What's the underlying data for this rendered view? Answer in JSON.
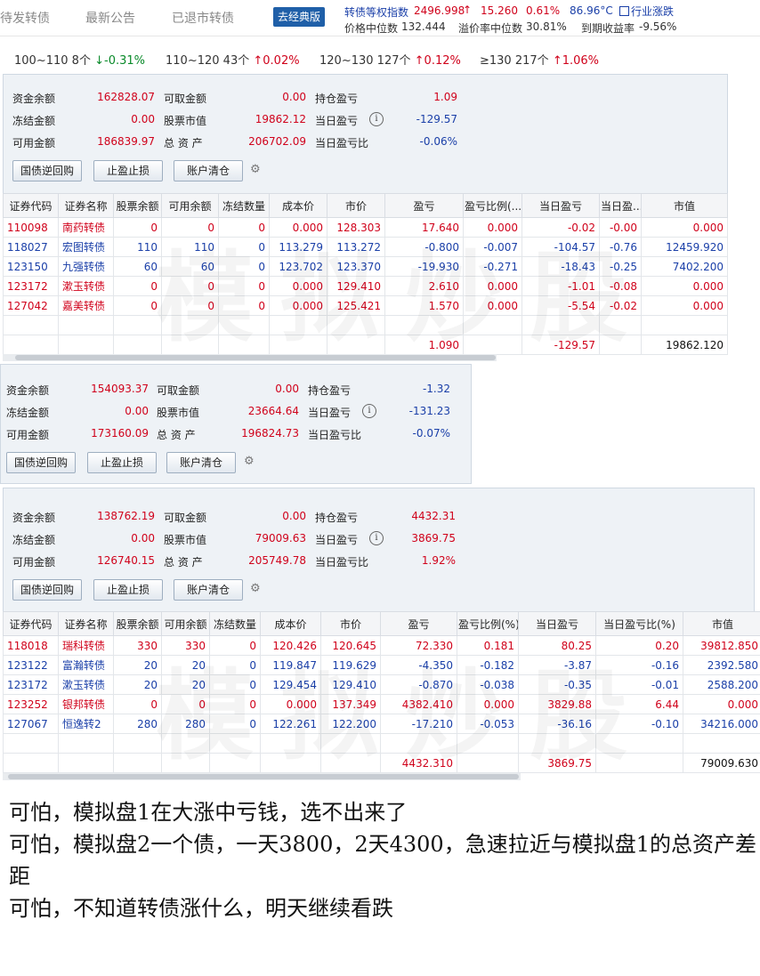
{
  "topbar": {
    "tabs": [
      "待发转债",
      "最新公告",
      "已退市转债"
    ],
    "classic_button": "去经典版",
    "index_label": "转债等权指数",
    "index_value": "2496.998",
    "index_arrow": "↑",
    "index_change": "15.260",
    "index_pct": "0.61%",
    "temperature": "86.96°C",
    "industry_link": "行业涨跌",
    "median_price_label": "价格中位数",
    "median_price": "132.444",
    "premium_median_label": "溢价率中位数",
    "premium_median": "30.81%",
    "ytm_label": "到期收益率",
    "ytm": "-9.56%"
  },
  "ranges": [
    {
      "range": "100~110",
      "count": "8个",
      "arrow": "↓",
      "pct": "-0.31%",
      "color": "green"
    },
    {
      "range": "110~120",
      "count": "43个",
      "arrow": "↑",
      "pct": "0.02%",
      "color": "red"
    },
    {
      "range": "120~130",
      "count": "127个",
      "arrow": "↑",
      "pct": "0.12%",
      "color": "red"
    },
    {
      "range": "≥130",
      "count": "217个",
      "arrow": "↑",
      "pct": "1.06%",
      "color": "red"
    }
  ],
  "labels": {
    "cash_balance": "资金余额",
    "withdrawable": "可取金额",
    "position_pnl": "持仓盈亏",
    "frozen": "冻结金额",
    "stock_value": "股票市值",
    "day_pnl": "当日盈亏",
    "available": "可用金额",
    "total_assets": "总 资 产",
    "day_pnl_ratio": "当日盈亏比",
    "btn_repo": "国债逆回购",
    "btn_stop": "止盈止损",
    "btn_clear": "账户清仓",
    "info_glyph": "i"
  },
  "panel1": {
    "cash_balance": "162828.07",
    "withdrawable": "0.00",
    "position_pnl": "1.09",
    "frozen": "0.00",
    "stock_value": "19862.12",
    "day_pnl": "-129.57",
    "available": "186839.97",
    "total_assets": "206702.09",
    "day_pnl_ratio": "-0.06%"
  },
  "table1": {
    "headers": [
      "证券代码",
      "证券名称",
      "股票余额",
      "可用余额",
      "冻结数量",
      "成本价",
      "市价",
      "盈亏",
      "盈亏比例(...",
      "当日盈亏",
      "当日盈...",
      "市值"
    ],
    "rows": [
      {
        "color": "red",
        "cells": [
          "110098",
          "南药转债",
          "0",
          "0",
          "0",
          "0.000",
          "128.303",
          "17.640",
          "0.000",
          "-0.02",
          "-0.00",
          "0.000"
        ]
      },
      {
        "color": "blue",
        "cells": [
          "118027",
          "宏图转债",
          "110",
          "110",
          "0",
          "113.279",
          "113.272",
          "-0.800",
          "-0.007",
          "-104.57",
          "-0.76",
          "12459.920"
        ]
      },
      {
        "color": "blue",
        "cells": [
          "123150",
          "九强转债",
          "60",
          "60",
          "0",
          "123.702",
          "123.370",
          "-19.930",
          "-0.271",
          "-18.43",
          "-0.25",
          "7402.200"
        ]
      },
      {
        "color": "red",
        "cells": [
          "123172",
          "漱玉转债",
          "0",
          "0",
          "0",
          "0.000",
          "129.410",
          "2.610",
          "0.000",
          "-1.01",
          "-0.08",
          "0.000"
        ]
      },
      {
        "color": "red",
        "cells": [
          "127042",
          "嘉美转债",
          "0",
          "0",
          "0",
          "0.000",
          "125.421",
          "1.570",
          "0.000",
          "-5.54",
          "-0.02",
          "0.000"
        ]
      }
    ],
    "sum": {
      "pnl": "1.090",
      "day_pnl": "-129.57",
      "value": "19862.120"
    }
  },
  "panel2": {
    "cash_balance": "154093.37",
    "withdrawable": "0.00",
    "position_pnl": "-1.32",
    "frozen": "0.00",
    "stock_value": "23664.64",
    "day_pnl": "-131.23",
    "available": "173160.09",
    "total_assets": "196824.73",
    "day_pnl_ratio": "-0.07%"
  },
  "panel3": {
    "cash_balance": "138762.19",
    "withdrawable": "0.00",
    "position_pnl": "4432.31",
    "frozen": "0.00",
    "stock_value": "79009.63",
    "day_pnl": "3869.75",
    "available": "126740.15",
    "total_assets": "205749.78",
    "day_pnl_ratio": "1.92%"
  },
  "table3": {
    "headers": [
      "证券代码",
      "证券名称",
      "股票余额",
      "可用余额",
      "冻结数量",
      "成本价",
      "市价",
      "盈亏",
      "盈亏比例(%)",
      "当日盈亏",
      "当日盈亏比(%)",
      "市值"
    ],
    "rows": [
      {
        "color": "red",
        "cells": [
          "118018",
          "瑞科转债",
          "330",
          "330",
          "0",
          "120.426",
          "120.645",
          "72.330",
          "0.181",
          "80.25",
          "0.20",
          "39812.850"
        ]
      },
      {
        "color": "blue",
        "cells": [
          "123122",
          "富瀚转债",
          "20",
          "20",
          "0",
          "119.847",
          "119.629",
          "-4.350",
          "-0.182",
          "-3.87",
          "-0.16",
          "2392.580"
        ]
      },
      {
        "color": "blue",
        "cells": [
          "123172",
          "漱玉转债",
          "20",
          "20",
          "0",
          "129.454",
          "129.410",
          "-0.870",
          "-0.038",
          "-0.35",
          "-0.01",
          "2588.200"
        ]
      },
      {
        "color": "red",
        "cells": [
          "123252",
          "银邦转债",
          "0",
          "0",
          "0",
          "0.000",
          "137.349",
          "4382.410",
          "0.000",
          "3829.88",
          "6.44",
          "0.000"
        ]
      },
      {
        "color": "blue",
        "cells": [
          "127067",
          "恒逸转2",
          "280",
          "280",
          "0",
          "122.261",
          "122.200",
          "-17.210",
          "-0.053",
          "-36.16",
          "-0.10",
          "34216.000"
        ]
      }
    ],
    "sum": {
      "pnl": "4432.310",
      "day_pnl": "3869.75",
      "value": "79009.630"
    }
  },
  "watermark": "模拟炒股",
  "caption": [
    "可怕，模拟盘1在大涨中亏钱，选不出来了",
    "可怕，模拟盘2一个债，一天3800，2天4300，急速拉近与模拟盘1的总资产差距",
    "可怕，不知道转债涨什么，明天继续看跌"
  ]
}
